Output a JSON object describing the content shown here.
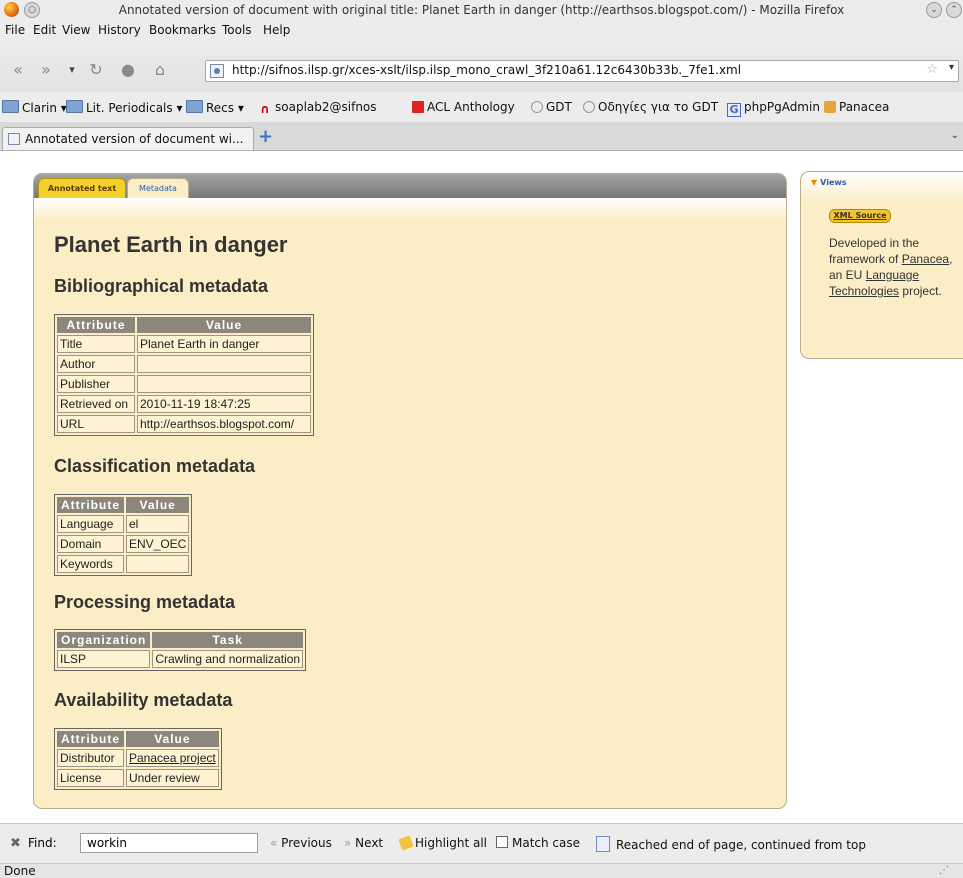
{
  "window": {
    "title": "Annotated version of document with original title: Planet Earth in danger (http://earthsos.blogspot.com/) - Mozilla Firefox"
  },
  "menu": {
    "items": [
      "File",
      "Edit",
      "View",
      "History",
      "Bookmarks",
      "Tools",
      "Help"
    ]
  },
  "nav": {
    "url": "http://sifnos.ilsp.gr/xces-xslt/ilsp.ilsp_mono_crawl_3f210a61.12c6430b33b._7fe1.xml"
  },
  "bookmarks": {
    "items": [
      "Clarin",
      "Lit. Periodicals",
      "Recs",
      "soaplab2@sifnos",
      "ACL Anthology",
      "GDT",
      "Οδηγίες για το GDT",
      "phpPgAdmin",
      "Panacea"
    ]
  },
  "tabs": {
    "active_label": "Annotated version of document wi..."
  },
  "page": {
    "tabs": {
      "annotated": "Annotated text",
      "metadata": "Metadata"
    },
    "title": "Planet Earth in danger",
    "bibliographical": {
      "heading": "Bibliographical metadata",
      "headers": [
        "Attribute",
        "Value"
      ],
      "rows": [
        [
          "Title",
          "Planet Earth in danger"
        ],
        [
          "Author",
          ""
        ],
        [
          "Publisher",
          ""
        ],
        [
          "Retrieved on",
          "2010-11-19 18:47:25"
        ],
        [
          "URL",
          "http://earthsos.blogspot.com/"
        ]
      ]
    },
    "classification": {
      "heading": "Classification metadata",
      "headers": [
        "Attribute",
        "Value"
      ],
      "rows": [
        [
          "Language",
          "el"
        ],
        [
          "Domain",
          "ENV_OEC"
        ],
        [
          "Keywords",
          ""
        ]
      ]
    },
    "processing": {
      "heading": "Processing metadata",
      "headers": [
        "Organization",
        "Task"
      ],
      "rows": [
        [
          "ILSP",
          "Crawling and normalization"
        ]
      ]
    },
    "availability": {
      "heading": "Availability metadata",
      "headers": [
        "Attribute",
        "Value"
      ],
      "rows": [
        [
          "Distributor",
          "Panacea project"
        ],
        [
          "License",
          "Under review"
        ]
      ]
    }
  },
  "sidebar": {
    "views_label": "Views",
    "xml_source": "XML Source",
    "text_before": "Developed in the framework of",
    "panacea_link": "Panacea",
    "text_mid": ", an EU",
    "lt_link": "Language Technologies",
    "text_after": "project."
  },
  "findbar": {
    "label": "Find:",
    "value": "workin",
    "previous": "Previous",
    "next": "Next",
    "highlight": "Highlight all",
    "match_case": "Match case",
    "status": "Reached end of page, continued from top"
  },
  "status": {
    "text": "Done"
  }
}
